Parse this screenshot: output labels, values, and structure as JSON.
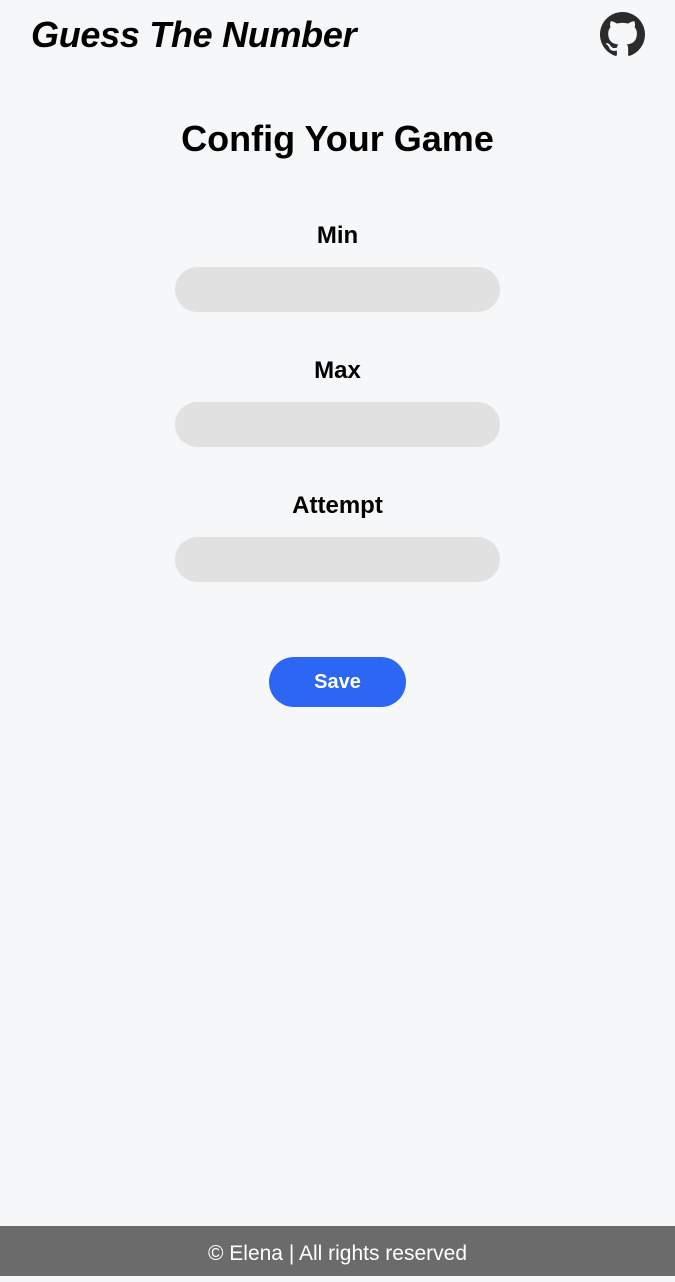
{
  "header": {
    "app_title": "Guess The Number",
    "github_icon": "github-icon"
  },
  "config": {
    "title": "Config Your Game",
    "fields": [
      {
        "label": "Min",
        "value": "",
        "placeholder": ""
      },
      {
        "label": "Max",
        "value": "",
        "placeholder": ""
      },
      {
        "label": "Attempt",
        "value": "",
        "placeholder": ""
      }
    ],
    "save_label": "Save"
  },
  "footer": {
    "text": "© Elena | All rights reserved"
  },
  "colors": {
    "background": "#f6f7f9",
    "input_background": "#e1e1e1",
    "accent": "#2c66f5",
    "footer_background": "#6b6b6b",
    "footer_text": "#ffffff"
  }
}
